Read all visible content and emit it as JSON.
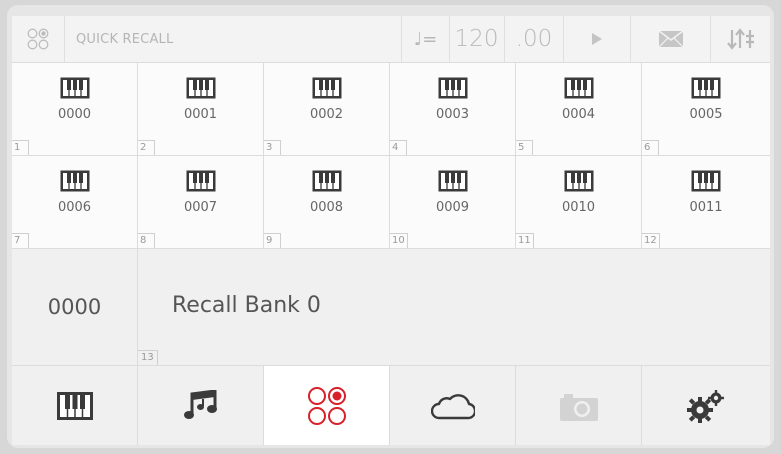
{
  "topbar": {
    "title": "QUICK RECALL",
    "tempo_symbol": "♩=",
    "tempo_value": "120",
    "tempo_decimal": ".00"
  },
  "presets": [
    {
      "name": "0000",
      "slot": "1"
    },
    {
      "name": "0001",
      "slot": "2"
    },
    {
      "name": "0002",
      "slot": "3"
    },
    {
      "name": "0003",
      "slot": "4"
    },
    {
      "name": "0004",
      "slot": "5"
    },
    {
      "name": "0005",
      "slot": "6"
    },
    {
      "name": "0006",
      "slot": "7"
    },
    {
      "name": "0007",
      "slot": "8"
    },
    {
      "name": "0008",
      "slot": "9"
    },
    {
      "name": "0009",
      "slot": "10"
    },
    {
      "name": "0010",
      "slot": "11"
    },
    {
      "name": "0011",
      "slot": "12"
    }
  ],
  "bank": {
    "number": "0000",
    "name": "Recall Bank 0",
    "slot": "13"
  },
  "nav": [
    {
      "icon": "piano-icon",
      "active": false
    },
    {
      "icon": "music-notes-icon",
      "active": false
    },
    {
      "icon": "quick-recall-icon",
      "active": true
    },
    {
      "icon": "cloud-icon",
      "active": false
    },
    {
      "icon": "camera-icon",
      "active": false,
      "disabled": true
    },
    {
      "icon": "gears-icon",
      "active": false
    }
  ],
  "colors": {
    "accent": "#d8202a",
    "icon_dark": "#3a3a3a",
    "icon_disabled": "#d0d0d0",
    "topbar_icon": "#b7b7b7"
  }
}
